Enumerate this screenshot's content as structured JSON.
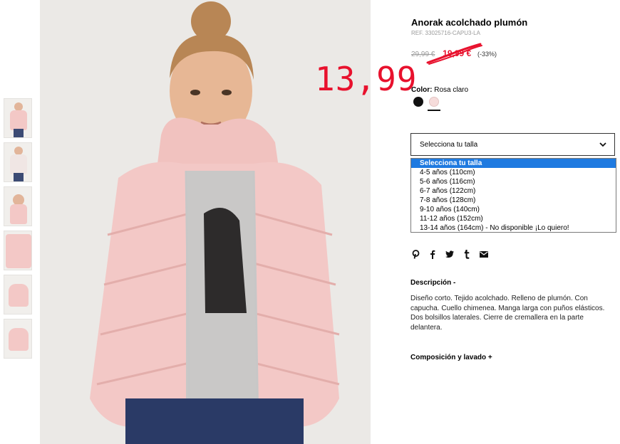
{
  "product": {
    "title": "Anorak acolchado plumón",
    "ref": "REF. 33025716-CAPU3-LA",
    "old_price": "29,99 €",
    "sale_price": "19,99 €",
    "discount": "(-33%)",
    "handwritten_price": "13,99"
  },
  "color": {
    "label": "Color:",
    "value": "Rosa claro",
    "swatches": [
      {
        "name": "black",
        "hex": "#111111"
      },
      {
        "name": "rosa-claro",
        "hex": "#f6dcdb"
      }
    ]
  },
  "size_select": {
    "label": "Selecciona tu talla",
    "options": [
      "Selecciona tu talla",
      "4-5 años (110cm)",
      "5-6 años (116cm)",
      "6-7 años (122cm)",
      "7-8 años (128cm)",
      "9-10 años (140cm)",
      "11-12 años (152cm)",
      "13-14 años (164cm) - No disponible ¡Lo quiero!"
    ],
    "selected_index": 0
  },
  "social": [
    "pinterest-icon",
    "facebook-icon",
    "twitter-icon",
    "tumblr-icon",
    "email-icon"
  ],
  "description": {
    "heading": "Descripción -",
    "text": "Diseño corto. Tejido acolchado. Relleno de plumón. Con capucha. Cuello chimenea. Manga larga con puños elásticos. Dos bolsillos laterales. Cierre de cremallera en la parte delantera."
  },
  "composition": {
    "heading": "Composición y lavado +"
  },
  "colors": {
    "sale_red": "#e8112d",
    "select_highlight": "#1f7ae0",
    "jacket_pink": "#f3c8c6"
  }
}
